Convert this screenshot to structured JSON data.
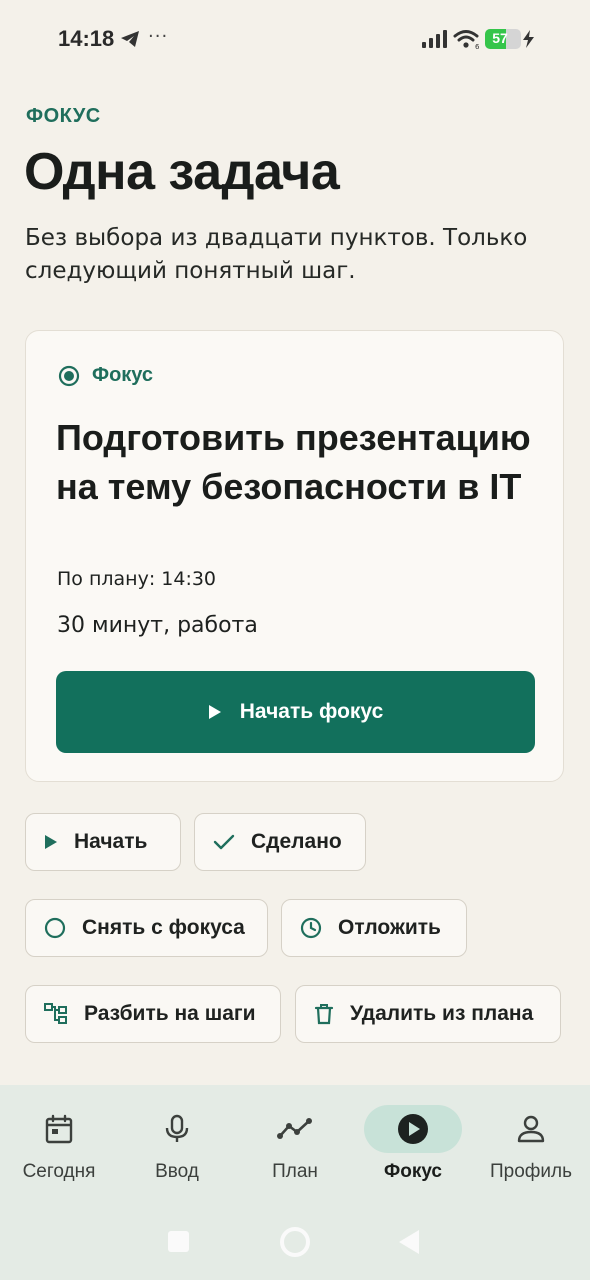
{
  "status_bar": {
    "time": "14:18",
    "more": "···",
    "battery_level": "57",
    "battery_fraction": 0.57
  },
  "header": {
    "eyebrow": "ФОКУС",
    "title": "Одна задача",
    "subtitle": "Без выбора из двадцати пунктов. Только следующий понятный шаг."
  },
  "card": {
    "label": "Фокус",
    "task_title": "Подготовить презентацию на тему безопасности в IT",
    "planned_time": "По плану: 14:30",
    "meta": "30 минут, работа",
    "start_focus_label": "Начать фокус"
  },
  "actions": {
    "start": "Начать",
    "done": "Сделано",
    "unfocus": "Снять с фокуса",
    "postpone": "Отложить",
    "split": "Разбить на шаги",
    "remove": "Удалить из плана"
  },
  "nav": {
    "items": [
      {
        "label": "Сегодня",
        "icon": "calendar-icon"
      },
      {
        "label": "Ввод",
        "icon": "microphone-icon"
      },
      {
        "label": "План",
        "icon": "trend-icon"
      },
      {
        "label": "Фокус",
        "icon": "play-circle-icon"
      },
      {
        "label": "Профиль",
        "icon": "profile-icon"
      }
    ],
    "active_index": 3
  },
  "colors": {
    "accent": "#12705c",
    "accent_text": "#1f6e5c",
    "background": "#f4f1ea",
    "nav_background": "#e4ebe5",
    "nav_active_pill": "#c8e2d8"
  }
}
